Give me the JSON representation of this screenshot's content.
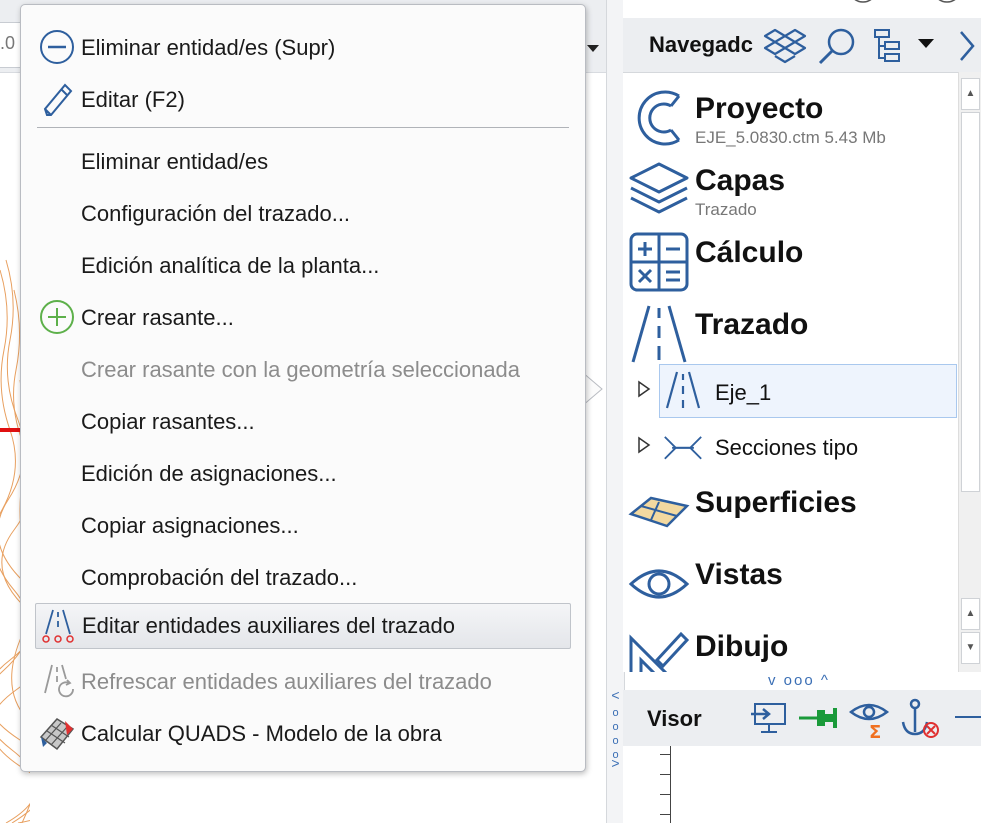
{
  "canvas": {
    "top_field_text": ".0"
  },
  "navigator": {
    "title": "Navegadc",
    "categories": [
      {
        "title": "Proyecto",
        "subtitle": "EJE_5.0830.ctm 5.43 Mb",
        "icon": "project-c-icon"
      },
      {
        "title": "Capas",
        "subtitle": "Trazado",
        "icon": "layers-icon"
      },
      {
        "title": "Cálculo",
        "subtitle": "",
        "icon": "calculator-icon"
      },
      {
        "title": "Trazado",
        "subtitle": "",
        "icon": "road-icon"
      },
      {
        "title": "Superficies",
        "subtitle": "",
        "icon": "surface-icon"
      },
      {
        "title": "Vistas",
        "subtitle": "",
        "icon": "eye-icon"
      },
      {
        "title": "Dibujo",
        "subtitle": "",
        "icon": "drawing-icon"
      }
    ],
    "tree_items": [
      {
        "label": "Eje_1",
        "selected": true,
        "icon": "road-small-icon"
      },
      {
        "label": "Secciones tipo",
        "selected": false,
        "icon": "cross-section-icon"
      }
    ]
  },
  "visor": {
    "toggle": "v ooo ^",
    "side_toggle": "< oooo >",
    "title": "Visor"
  },
  "context_menu": {
    "items": [
      {
        "label": "Eliminar entidad/es (Supr)",
        "icon": "minus-circle-icon",
        "disabled": false
      },
      {
        "label": "Editar (F2)",
        "icon": "pencil-icon",
        "disabled": false
      },
      {
        "label": "Eliminar entidad/es",
        "icon": "",
        "disabled": false
      },
      {
        "label": "Configuración del trazado...",
        "icon": "",
        "disabled": false
      },
      {
        "label": "Edición analítica de la planta...",
        "icon": "",
        "disabled": false
      },
      {
        "label": "Crear rasante...",
        "icon": "plus-circle-icon",
        "disabled": false
      },
      {
        "label": "Crear rasante con la geometría seleccionada",
        "icon": "",
        "disabled": true
      },
      {
        "label": "Copiar rasantes...",
        "icon": "",
        "disabled": false
      },
      {
        "label": "Edición de asignaciones...",
        "icon": "",
        "disabled": false
      },
      {
        "label": "Copiar asignaciones...",
        "icon": "",
        "disabled": false
      },
      {
        "label": "Comprobación del trazado...",
        "icon": "",
        "disabled": false
      },
      {
        "label": "Editar entidades auxiliares del trazado",
        "icon": "road-aux-icon",
        "disabled": false,
        "hover": true
      },
      {
        "label": "Refrescar entidades auxiliares del trazado",
        "icon": "road-refresh-icon",
        "disabled": true
      },
      {
        "label": "Calcular QUADS - Modelo de la obra",
        "icon": "quads-icon",
        "disabled": false
      }
    ]
  },
  "colors": {
    "accent_blue": "#2e5f9e",
    "plus_green": "#5db04a",
    "selection_bg": "#eef4fd",
    "contour_orange": "#e8a060",
    "axis_red": "#e01010",
    "pin_green": "#1a9a3a",
    "sigma_orange": "#f07020"
  }
}
